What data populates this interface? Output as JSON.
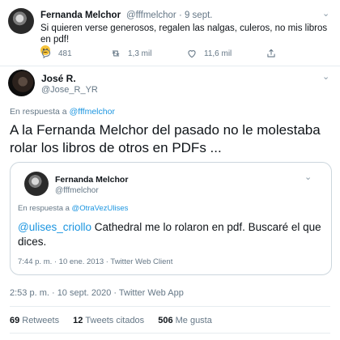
{
  "top_tweet": {
    "name": "Fernanda Melchor",
    "handle_date": "@fffmelchor · 9 sept.",
    "text": "Si quieren verse generosos, regalen las nalgas, culeros, no mis libros en pdf!",
    "actions": {
      "replies": "481",
      "retweets": "1,3 mil",
      "likes": "11,6 mil"
    }
  },
  "main_tweet": {
    "name": "José R.",
    "handle": "@Jose_R_YR",
    "reply_prefix": "En respuesta a",
    "reply_to": "@fffmelchor",
    "text": "A la Fernanda Melchor del pasado no le molestaba rolar los libros de otros en PDFs ...",
    "timestamp": "2:53 p. m. · 10 sept. 2020 · Twitter Web App"
  },
  "quoted_tweet": {
    "name": "Fernanda Melchor",
    "handle": "@fffmelchor",
    "reply_prefix": "En respuesta a",
    "reply_to": "@OtraVezUlises",
    "mention": "@ulises_criollo",
    "text": " Cathedral me lo rolaron en pdf. Buscaré el que dices.",
    "meta": "7:44 p. m. · 10 ene. 2013 · Twitter Web Client"
  },
  "stats": {
    "retweets_count": "69",
    "retweets_label": "Retweets",
    "quotes_count": "12",
    "quotes_label": "Tweets citados",
    "likes_count": "506",
    "likes_label": "Me gusta"
  },
  "colors": {
    "link": "#1b95e0",
    "secondary_text": "#657786",
    "primary_text": "#0f1419",
    "border": "#ccd6dd"
  },
  "icons": [
    "reply-icon",
    "retweet-icon",
    "like-icon",
    "share-icon",
    "chevron-down-icon",
    "weary-face-emoji"
  ]
}
